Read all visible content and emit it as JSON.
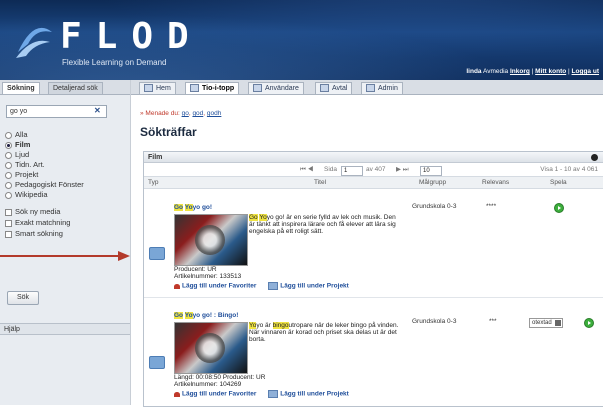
{
  "header": {
    "logo_text": "FLOD",
    "logo_subtitle": "Flexible Learning on Demand",
    "user_name": "linda",
    "user_org": "Avmedia",
    "links": [
      "Inkorg",
      "Mitt konto",
      "Logga ut"
    ],
    "sep": "|"
  },
  "left_panel": {
    "tabs": [
      "Sökning",
      "Detaljerad sök"
    ],
    "search_value": "go yo",
    "clear_icon": "✕",
    "media_types": [
      {
        "label": "Alla",
        "selected": false
      },
      {
        "label": "Film",
        "selected": true
      },
      {
        "label": "Ljud",
        "selected": false
      },
      {
        "label": "Tidn. Art.",
        "selected": false
      },
      {
        "label": "Projekt",
        "selected": false
      },
      {
        "label": "Pedagogiskt Fönster",
        "selected": false
      },
      {
        "label": "Wikipedia",
        "selected": false
      }
    ],
    "checkboxes": [
      "Sök ny media",
      "Exakt matchning",
      "Smart sökning"
    ],
    "search_button": "Sök",
    "help": "Hjälp"
  },
  "top_tabs": [
    "Hem",
    "Tio-i-topp",
    "Användare",
    "Avtal",
    "Admin"
  ],
  "breadcrumb": {
    "prefix": "» Menade du:",
    "suggestions": [
      "go",
      "god",
      "godh"
    ]
  },
  "page_title": "Sökträffar",
  "grid": {
    "section": "Film",
    "pager": {
      "page_label": "Sida",
      "page": "1",
      "of_label": "av 407",
      "per_page": "10",
      "summary": "Visa 1 - 10 av 4 061"
    },
    "columns": [
      "Typ",
      "Titel",
      "Målgrupp",
      "Relevans",
      "Spela"
    ],
    "rows": [
      {
        "title_hl": "Go",
        "title_mid": " ",
        "title_hl2": "Yo",
        "title_rest": "yo go!",
        "desc_hl": "Go",
        "desc_mid": " ",
        "desc_hl2": "Yo",
        "desc_rest": "yo go! är en serie fylld av lek och musik. Den är tänkt att inspirera lärare och få elever att lära sig engelska på ett roligt sätt.",
        "producer": "Producent: UR",
        "article": "Artikelnummer: 133513",
        "fav": "Lägg till under Favoriter",
        "proj": "Lägg till under Projekt",
        "target": "Grundskola 0-3",
        "relevance": "****"
      },
      {
        "title_hl": "Go",
        "title_mid": " ",
        "title_hl2": "Yo",
        "title_rest": "yo go! : Bingo!",
        "desc_hl": "Yo",
        "desc_mid": "yo är ",
        "desc_hl2": "bingo",
        "desc_rest": "utropare när de leker bingo på vinden. När vinnaren är korad och priset ska delas ut är det borta.",
        "length": "Längd: 00:08:50  Producent: UR",
        "article": "Artikelnummer: 104269",
        "fav": "Lägg till under Favoriter",
        "proj": "Lägg till under Projekt",
        "target": "Grundskola 0-3",
        "relevance": "***",
        "subtitle_option": "otextad"
      }
    ]
  }
}
